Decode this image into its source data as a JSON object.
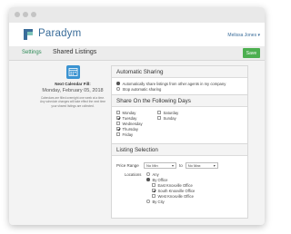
{
  "app": {
    "brand": "Paradym",
    "user_menu": "Melissa Jones ▾",
    "nav_settings": "Settings",
    "page_title": "Shared Listings",
    "save_label": "Save"
  },
  "sidebar": {
    "next_fill_label": "Next Calendar Fill:",
    "next_fill_date": "Monday, February 05, 2018",
    "note": "Calendars are filled overnight one week at a time. Any schedule changes will take effect the next time your shared listings are collected."
  },
  "automatic_sharing": {
    "title": "Automatic Sharing",
    "options": [
      {
        "label": "Automatically share listings from other agents in my company",
        "selected": true
      },
      {
        "label": "Stop automatic sharing",
        "selected": false
      }
    ]
  },
  "days": {
    "title": "Share On the Following Days",
    "left": [
      {
        "label": "Monday",
        "checked": false
      },
      {
        "label": "Tuesday",
        "checked": true
      },
      {
        "label": "Wednesday",
        "checked": false
      },
      {
        "label": "Thursday",
        "checked": true
      },
      {
        "label": "Friday",
        "checked": false
      }
    ],
    "right": [
      {
        "label": "Saturday",
        "checked": false
      },
      {
        "label": "Sunday",
        "checked": false
      }
    ]
  },
  "listing_selection": {
    "title": "Listing Selection",
    "price_label": "Price Range",
    "min_value": "No Min",
    "to_label": "to",
    "max_value": "No Max",
    "locations_label": "Locations",
    "any": {
      "label": "Any",
      "selected": false
    },
    "by_office": {
      "label": "By Office",
      "selected": true
    },
    "offices": [
      {
        "label": "East Knoxville Office",
        "checked": false
      },
      {
        "label": "South Knoxville Office",
        "checked": true
      },
      {
        "label": "West Knoxville Office",
        "checked": false
      }
    ],
    "by_city": {
      "label": "By City",
      "selected": false
    }
  },
  "colors": {
    "accent_green": "#4caf50",
    "link_blue": "#3a6d9a",
    "calendar_blue": "#3b93d1"
  }
}
